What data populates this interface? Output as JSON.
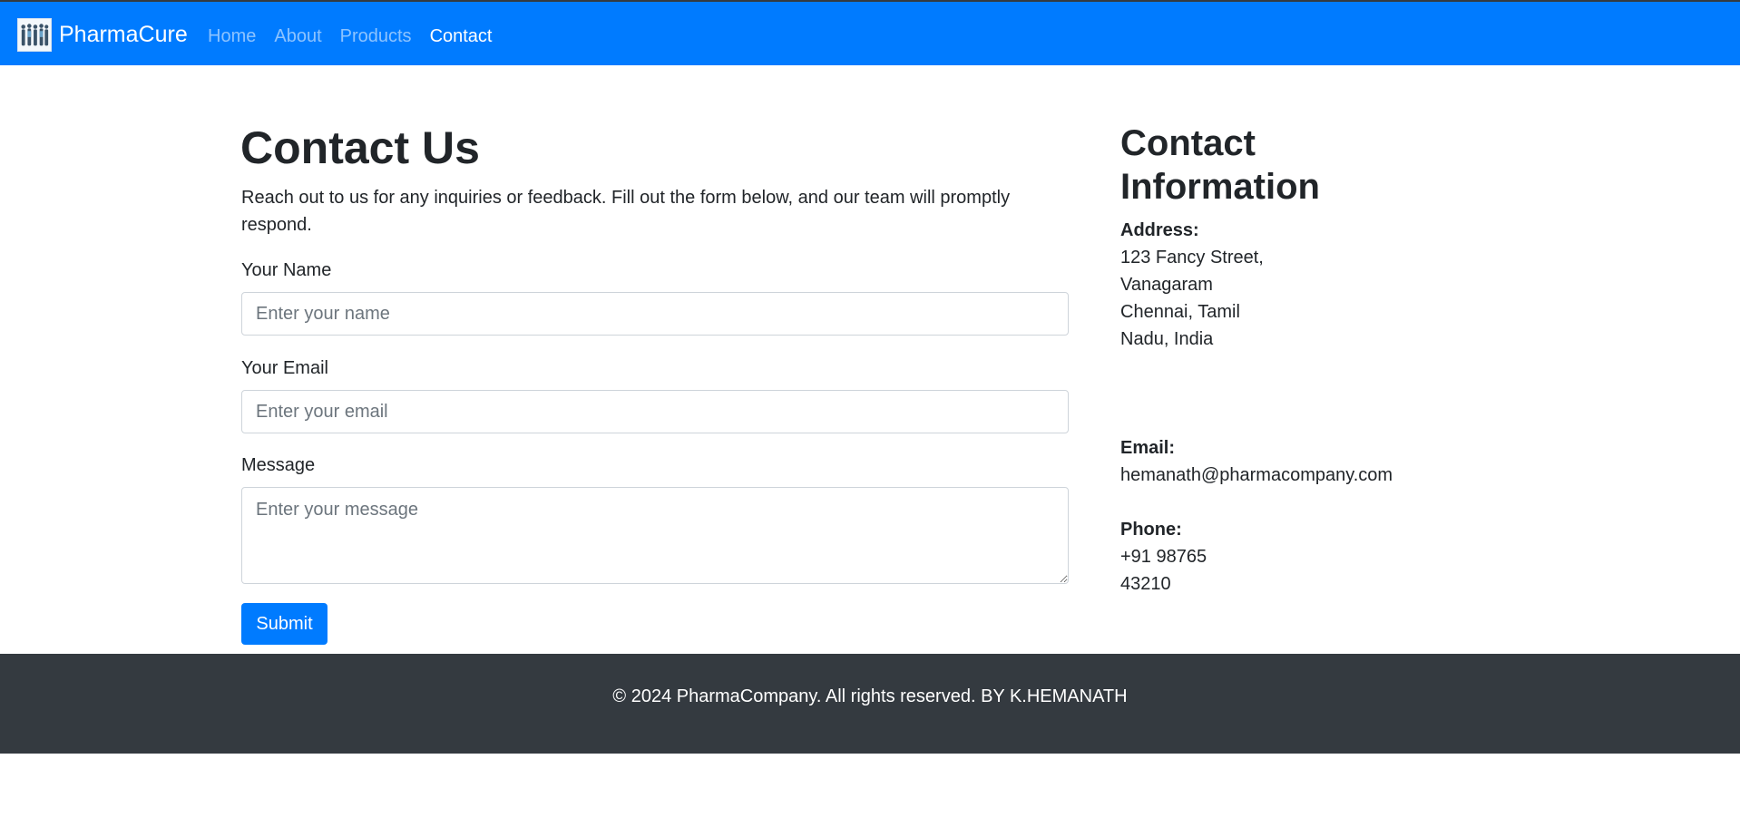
{
  "navbar": {
    "brand": "PharmaCure",
    "logo_icon": "people-group-logo-icon",
    "background": "#007bff",
    "links": [
      {
        "label": "Home",
        "active": false
      },
      {
        "label": "About",
        "active": false
      },
      {
        "label": "Products",
        "active": false
      },
      {
        "label": "Contact",
        "active": true
      }
    ]
  },
  "contact_form": {
    "title": "Contact Us",
    "intro": "Reach out to us for any inquiries or feedback. Fill out the form below, and our team will promptly respond.",
    "name_label": "Your Name",
    "name_placeholder": "Enter your name",
    "name_value": "",
    "email_label": "Your Email",
    "email_placeholder": "Enter your email",
    "email_value": "",
    "message_label": "Message",
    "message_placeholder": "Enter your message",
    "message_value": "",
    "submit_label": "Submit"
  },
  "contact_info": {
    "title": "Contact Information",
    "address_label": "Address:",
    "address_value": "123 Fancy Street, Vanagaram Chennai, Tamil Nadu, India",
    "email_label": "Email:",
    "email_value": "hemanath@pharmacompany.com",
    "phone_label": "Phone:",
    "phone_value": "+91 98765 43210"
  },
  "footer": {
    "text": "© 2024 PharmaCompany. All rights reserved. BY K.HEMANATH",
    "background": "#343a40"
  }
}
